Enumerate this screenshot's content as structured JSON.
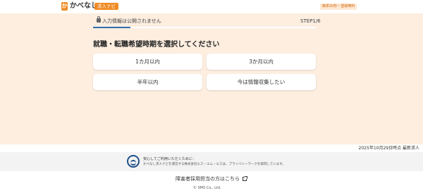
{
  "header": {
    "logo_mark": "か",
    "logo_text": "かべなし",
    "logo_badge": "求人ナビ",
    "right_badge": "簡単20秒・登録無料"
  },
  "form": {
    "notice": "入力情報は公開されません",
    "step": "STEP1/6",
    "progress_fraction": 0.1667,
    "question": "就職・転職希望時期を選択してください",
    "options": [
      "1カ月以内",
      "3か月以内",
      "半年以内",
      "今は情報収集したい"
    ]
  },
  "footer": {
    "update_date": "2025年10月29日時点 最新求人",
    "privacy_title": "安心してご利用いただくために：",
    "privacy_body": "かべなし求人ナビを運営する株式会社エス・エム・エスは、プライバシーマークを取得しています。",
    "employer_link": "障害者採用担当の方はこちら",
    "copyright": "© SMS Co., Ltd."
  },
  "colors": {
    "accent": "#f08a24",
    "main_background": "#fdeee0",
    "progress": "#2e6fae"
  },
  "icons": [
    "lock-icon",
    "privacy-mark-icon",
    "external-link-icon"
  ]
}
